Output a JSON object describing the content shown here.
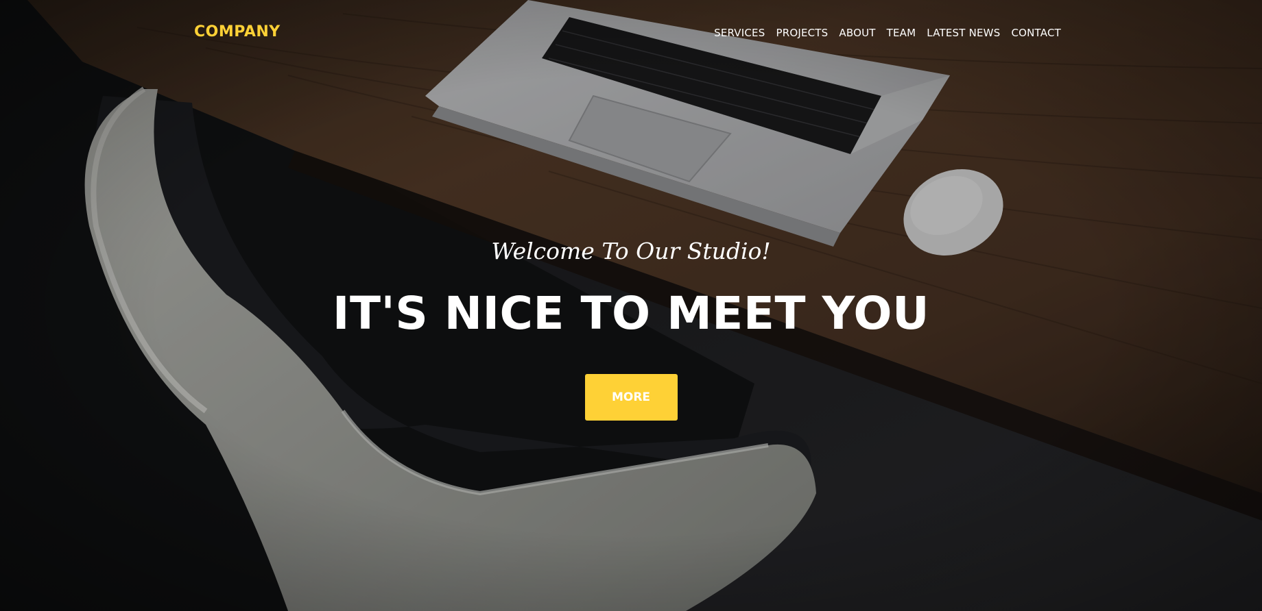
{
  "brand": {
    "name": "COMPANY",
    "color": "#fed136"
  },
  "nav": {
    "items": [
      {
        "label": "SERVICES"
      },
      {
        "label": "PROJECTS"
      },
      {
        "label": "ABOUT"
      },
      {
        "label": "TEAM"
      },
      {
        "label": "LATEST NEWS"
      },
      {
        "label": "CONTACT"
      }
    ]
  },
  "hero": {
    "lead": "Welcome To Our Studio!",
    "heading": "IT'S NICE TO MEET YOU",
    "button_label": "MORE",
    "button_color": "#fed136"
  },
  "background": {
    "icons": [
      "laptop-icon",
      "mouse-icon",
      "chair-icon",
      "desk-icon"
    ]
  }
}
